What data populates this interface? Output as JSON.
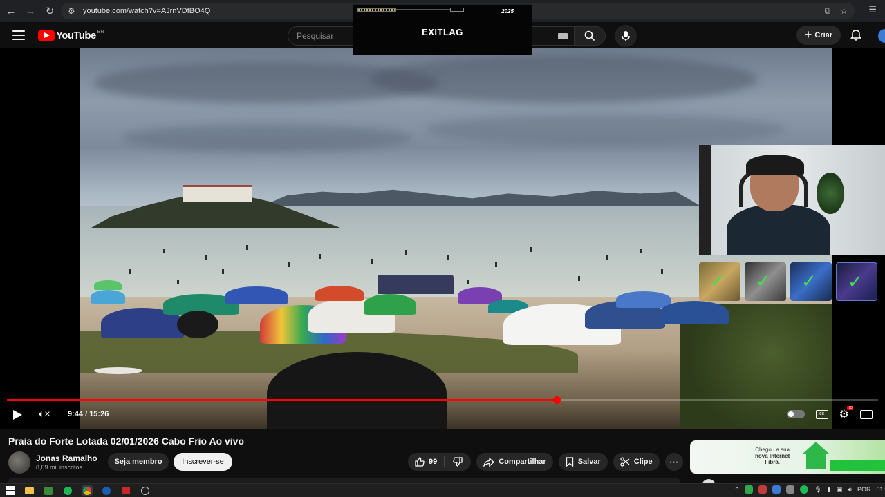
{
  "browser": {
    "url": "youtube.com/watch?v=AJrnVDfBO4Q",
    "back_icon": "arrow-left",
    "forward_icon": "arrow-right",
    "reload_icon": "reload",
    "site_settings_icon": "tune",
    "install_icon": "install-app",
    "bookmark_icon": "star",
    "menu_icon": "reading-list"
  },
  "youtube": {
    "logo_text": "YouTube",
    "country_code": "BR",
    "search_placeholder": "Pesquisar",
    "create_label": "Criar"
  },
  "overlay": {
    "brand": "EXITLAG",
    "brand2_line1": "2025",
    "dots": ".."
  },
  "player": {
    "current_time": "9:44",
    "duration": "15:26",
    "timecode": "9:44 / 15:26",
    "progress_fraction": 0.6307,
    "hd_badge": "HD"
  },
  "video": {
    "title": "Praia do Forte Lotada 02/01/2026 Cabo Frio Ao vivo",
    "channel_name": "Jonas Ramalho",
    "subscribers": "8,09 mil inscritos",
    "member_label": "Seja membro",
    "subscribe_label": "Inscrever-se",
    "like_count": "99",
    "share_label": "Compartilhar",
    "save_label": "Salvar",
    "clip_label": "Clipe"
  },
  "ad": {
    "line1": "Chegou a sua",
    "line2": "nova Internet",
    "line3": "Fibra."
  },
  "taskbar": {
    "language": "POR",
    "clock": "01:"
  },
  "colors": {
    "youtube_red": "#ff0000",
    "progress_red": "#ff0000",
    "background": "#0f0f0f",
    "button_bg": "#272727",
    "subscribe_bg": "#f1f1f1",
    "checkmark_green": "#3ee34c"
  }
}
